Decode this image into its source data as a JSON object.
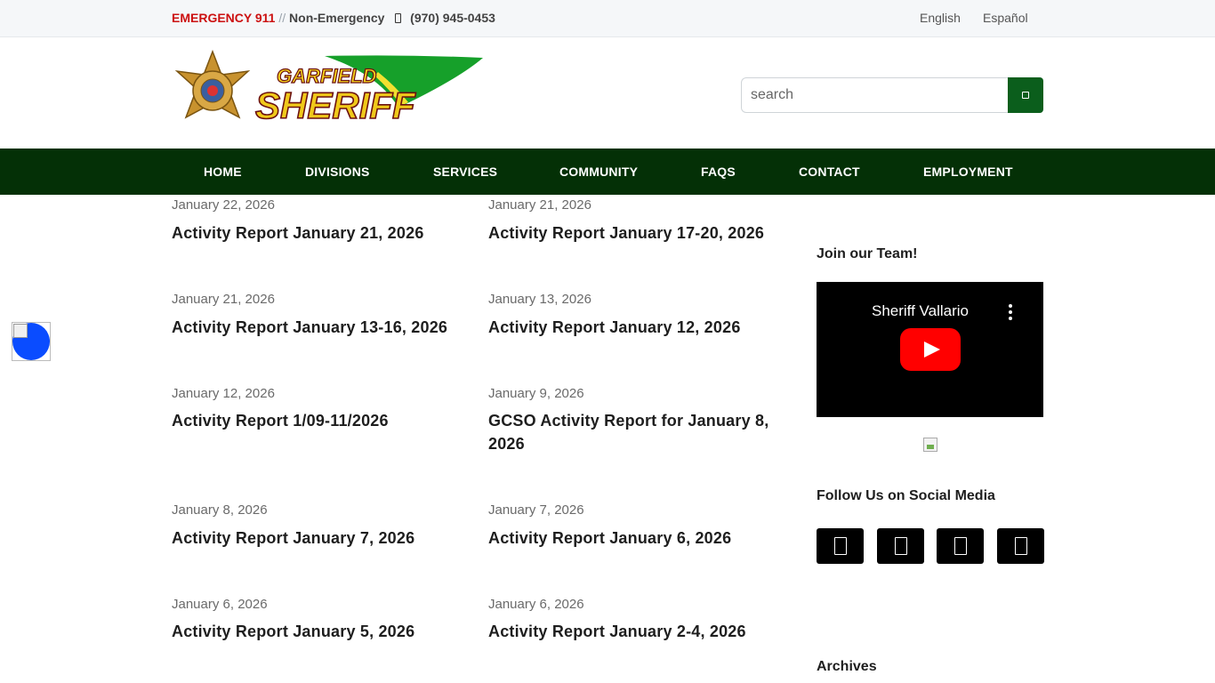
{
  "topbar": {
    "emergency": "EMERGENCY 911",
    "separator": "//",
    "non_emergency": "Non-Emergency",
    "phone": "(970) 945-0453",
    "languages": [
      "English",
      "Español"
    ]
  },
  "header": {
    "logo_text_top": "GARFIELD",
    "logo_text_main": "SHERIFF",
    "search_placeholder": "search"
  },
  "nav": {
    "items": [
      "HOME",
      "DIVISIONS",
      "SERVICES",
      "COMMUNITY",
      "FAQS",
      "CONTACT",
      "EMPLOYMENT"
    ]
  },
  "posts": [
    {
      "date": "January 22, 2026",
      "title": "Activity Report January 21, 2026"
    },
    {
      "date": "January 21, 2026",
      "title": "Activity Report January 17-20, 2026"
    },
    {
      "date": "January 21, 2026",
      "title": "Activity Report January 13-16, 2026"
    },
    {
      "date": "January 13, 2026",
      "title": "Activity Report January 12, 2026"
    },
    {
      "date": "January 12, 2026",
      "title": "Activity Report 1/09-11/2026"
    },
    {
      "date": "January 9, 2026",
      "title": "GCSO Activity Report for January 8, 2026"
    },
    {
      "date": "January 8, 2026",
      "title": "Activity Report January 7, 2026"
    },
    {
      "date": "January 7, 2026",
      "title": "Activity Report January 6, 2026"
    },
    {
      "date": "January 6, 2026",
      "title": "Activity Report January 5, 2026"
    },
    {
      "date": "January 6, 2026",
      "title": "Activity Report January 2-4, 2026"
    }
  ],
  "sidebar": {
    "join_heading": "Join our Team!",
    "video_title": "Sheriff Vallario",
    "social_heading": "Follow Us on Social Media",
    "social_icons": [
      "facebook-icon",
      "twitter-icon",
      "instagram-icon",
      "youtube-icon"
    ],
    "archives_heading": "Archives"
  },
  "colors": {
    "emergency_red": "#cc1111",
    "nav_green": "#043006",
    "search_button_green": "#0b5e1c",
    "youtube_red": "#ff0000"
  }
}
